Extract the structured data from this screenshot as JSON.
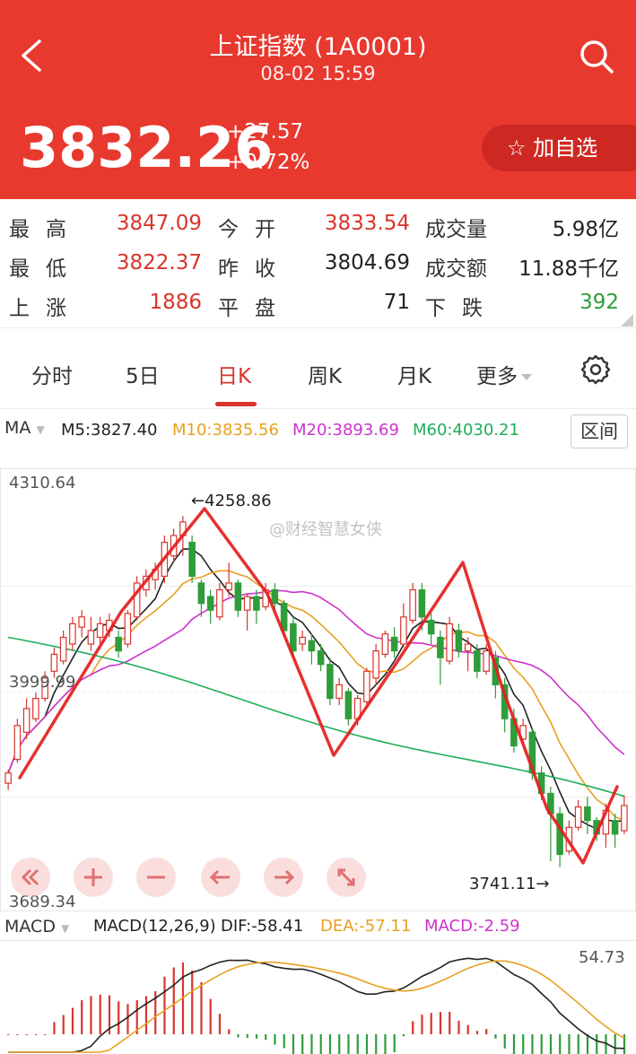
{
  "header": {
    "title": "上证指数 (1A0001)",
    "subtitle": "08-02  15:59",
    "price": "3832.26",
    "change": "+27.57",
    "change_pct": "+0.72%",
    "watchlist_label": "☆ 加自选",
    "bg_color": "#e8392f"
  },
  "stats": {
    "high_label": "最高",
    "high_value": "3847.09",
    "open_label": "今开",
    "open_value": "3833.54",
    "volume_label": "成交量",
    "volume_value": "5.98亿",
    "low_label": "最低",
    "low_value": "3822.37",
    "prevclose_label": "昨收",
    "prevclose_value": "3804.69",
    "turnover_label": "成交额",
    "turnover_value": "11.88千亿",
    "up_label": "上涨",
    "up_value": "1886",
    "flat_label": "平盘",
    "flat_value": "71",
    "down_label": "下跌",
    "down_value": "392"
  },
  "tabs": [
    "分时",
    "5日",
    "日K",
    "周K",
    "月K",
    "更多"
  ],
  "active_tab": "日K",
  "ma_bar": {
    "selector": "MA",
    "m5": "M5:3827.40",
    "m10": "M10:3835.56",
    "m20": "M20:3893.69",
    "m60": "M60:4030.21",
    "range_button": "区间"
  },
  "chart_labels": {
    "y_max": "4310.64",
    "y_mid": "3999.99",
    "y_min": "3689.34",
    "peak_annotation": "←4258.86",
    "low_annotation": "3741.11→",
    "watermark": "@财经智慧女侠"
  },
  "macd_bar": {
    "selector": "MACD",
    "params": "MACD(12,26,9)",
    "dif": "DIF:-58.41",
    "dea": "DEA:-57.11",
    "macd": "MACD:-2.59",
    "axis_max": "54.73"
  },
  "colors": {
    "up": "#d8352c",
    "down": "#2e9d3a",
    "m5": "#222222",
    "m10": "#e8a020",
    "m20": "#cc33cc",
    "m60": "#1fae5a",
    "dea": "#e8a020",
    "macd": "#cc33cc"
  },
  "chart_data": {
    "type": "candlestick",
    "y_range": [
      3689.34,
      4310.64
    ],
    "labeled_high": 4258.86,
    "labeled_low": 3741.11,
    "candles": [
      [
        3865,
        3880,
        3855,
        3885
      ],
      [
        3900,
        3950,
        3895,
        3960
      ],
      [
        3940,
        3975,
        3930,
        3990
      ],
      [
        3960,
        3990,
        3955,
        3999
      ],
      [
        3990,
        4020,
        3985,
        4030
      ],
      [
        4030,
        4055,
        4020,
        4065
      ],
      [
        4045,
        4080,
        4040,
        4090
      ],
      [
        4070,
        4100,
        4060,
        4110
      ],
      [
        4095,
        4110,
        4080,
        4120
      ],
      [
        4070,
        4090,
        4060,
        4110
      ],
      [
        4080,
        4100,
        4070,
        4110
      ],
      [
        4090,
        4105,
        4080,
        4115
      ],
      [
        4080,
        4060,
        4050,
        4090
      ],
      [
        4070,
        4115,
        4065,
        4120
      ],
      [
        4110,
        4160,
        4105,
        4170
      ],
      [
        4150,
        4170,
        4140,
        4180
      ],
      [
        4165,
        4180,
        4150,
        4190
      ],
      [
        4170,
        4220,
        4160,
        4230
      ],
      [
        4200,
        4230,
        4190,
        4240
      ],
      [
        4230,
        4250,
        4200,
        4258.86
      ],
      [
        4220,
        4170,
        4160,
        4230
      ],
      [
        4160,
        4130,
        4110,
        4165
      ],
      [
        4140,
        4120,
        4100,
        4150
      ],
      [
        4110,
        4150,
        4105,
        4160
      ],
      [
        4150,
        4160,
        4140,
        4190
      ],
      [
        4160,
        4120,
        4110,
        4165
      ],
      [
        4120,
        4140,
        4090,
        4145
      ],
      [
        4140,
        4120,
        4100,
        4150
      ],
      [
        4125,
        4150,
        4120,
        4160
      ],
      [
        4150,
        4130,
        4120,
        4160
      ],
      [
        4130,
        4090,
        4080,
        4135
      ],
      [
        4100,
        4060,
        4050,
        4110
      ],
      [
        4070,
        4080,
        4060,
        4090
      ],
      [
        4075,
        4060,
        4040,
        4085
      ],
      [
        4060,
        4040,
        4030,
        4070
      ],
      [
        4040,
        3990,
        3980,
        4050
      ],
      [
        3990,
        4010,
        3980,
        4020
      ],
      [
        4000,
        3960,
        3950,
        4005
      ],
      [
        3960,
        3990,
        3950,
        3995
      ],
      [
        3985,
        4030,
        3980,
        4035
      ],
      [
        4020,
        4060,
        4010,
        4070
      ],
      [
        4055,
        4085,
        4050,
        4090
      ],
      [
        4080,
        4060,
        4050,
        4095
      ],
      [
        4070,
        4110,
        4065,
        4130
      ],
      [
        4105,
        4150,
        4100,
        4160
      ],
      [
        4150,
        4110,
        4090,
        4160
      ],
      [
        4105,
        4085,
        4070,
        4115
      ],
      [
        4080,
        4050,
        4010,
        4090
      ],
      [
        4045,
        4100,
        4040,
        4110
      ],
      [
        4090,
        4060,
        4050,
        4100
      ],
      [
        4060,
        4070,
        4030,
        4080
      ],
      [
        4060,
        4030,
        4020,
        4070
      ],
      [
        4030,
        4060,
        4025,
        4070
      ],
      [
        4050,
        4010,
        3990,
        4060
      ],
      [
        4010,
        3960,
        3940,
        4020
      ],
      [
        3960,
        3920,
        3910,
        3975
      ],
      [
        3930,
        3950,
        3925,
        3960
      ],
      [
        3940,
        3880,
        3870,
        3945
      ],
      [
        3880,
        3850,
        3840,
        3890
      ],
      [
        3850,
        3820,
        3750,
        3860
      ],
      [
        3820,
        3760,
        3741.11,
        3830
      ],
      [
        3765,
        3800,
        3760,
        3810
      ],
      [
        3800,
        3830,
        3795,
        3840
      ],
      [
        3830,
        3810,
        3790,
        3845
      ],
      [
        3810,
        3790,
        3780,
        3815
      ],
      [
        3790,
        3825,
        3770,
        3835
      ],
      [
        3810,
        3790,
        3770,
        3820
      ],
      [
        3795,
        3832.26,
        3790,
        3847.09
      ]
    ]
  }
}
